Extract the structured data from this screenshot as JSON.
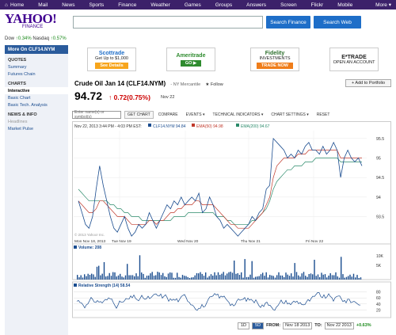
{
  "topnav": {
    "items": [
      "Home",
      "Mail",
      "News",
      "Sports",
      "Finance",
      "Weather",
      "Games",
      "Groups",
      "Answers",
      "Screen",
      "Flickr",
      "Mobile"
    ],
    "more": "More ▾"
  },
  "logo": {
    "main": "YAHOO!",
    "sub": "FINANCE"
  },
  "search": {
    "finance_btn": "Search Finance",
    "web_btn": "Search Web"
  },
  "ticker": {
    "dow_label": "Dow",
    "dow_change": "0.34%",
    "nasdaq_label": "Nasdaq",
    "nasdaq_change": "0.57%"
  },
  "sidebar": {
    "title": "More On CLF14.NYM",
    "sections": [
      {
        "heading": "QUOTES",
        "links": [
          "Summary",
          "Futures Chain"
        ]
      },
      {
        "heading": "CHARTS",
        "links": [
          "Interactive",
          "Basic Chart",
          "Basic Tech. Analysis"
        ]
      },
      {
        "heading": "NEWS & INFO",
        "links": [
          "Headlines",
          "Market Pulse"
        ]
      }
    ]
  },
  "ads": [
    {
      "brand": "Scottrade",
      "line": "Get Up to $1,000",
      "button": "See Details",
      "color": "#1e6ec8",
      "btn_color": "#f7a51c"
    },
    {
      "brand": "Ameritrade",
      "line": "",
      "button": "GO ▶",
      "color": "#2e8b2e",
      "btn_color": "#2e8b2e"
    },
    {
      "brand": "Fidelity",
      "line": "INVESTMENTS",
      "button": "TRADE NOW",
      "color": "#2b6e2b",
      "btn_color": "#ef7d1a"
    },
    {
      "brand": "E*TRADE",
      "line": "OPEN AN ACCOUNT",
      "button": "",
      "color": "#222",
      "btn_color": "#6b3fa0"
    }
  ],
  "quote": {
    "title": "Crude Oil Jan 14 (CLF14.NYM)",
    "exchange": "- NY Mercantile",
    "follow": "★ Follow",
    "price": "94.72",
    "change": "↑ 0.72(0.75%)",
    "date": "Nov 22",
    "add_portfolio": "+ Add to Portfolio"
  },
  "toolbar": {
    "compare_placeholder": "Enter name(s) or symbol(s)",
    "get_chart": "GET CHART",
    "items": [
      "COMPARE",
      "EVENTS ▾",
      "TECHNICAL INDICATORS ▾",
      "CHART SETTINGS ▾",
      "RESET"
    ]
  },
  "legend": {
    "date": "Nov 22, 2013 3:44 PM - 4:03 PM EST:",
    "series": [
      {
        "name": "CLF14.NYM 94.84",
        "color": "#1a4c8f"
      },
      {
        "name": "EMA(50) 94.98",
        "color": "#c0392b"
      },
      {
        "name": "EMA(200) 94.67",
        "color": "#2a8a6a"
      }
    ],
    "copyright": "© 2013 Yahoo! Inc."
  },
  "chart_data": {
    "type": "line",
    "main": {
      "x_labels": [
        "Tue Nov 19",
        "Wed Nov 20",
        "Thu Nov 21",
        "Fri Nov 22"
      ],
      "x_label_top": "Mon Nov 18, 2013",
      "y_ticks": [
        93.5,
        94.0,
        94.5,
        95.0,
        95.5
      ],
      "ylim": [
        92.9,
        95.7
      ],
      "price": [
        93.9,
        93.6,
        93.3,
        93.2,
        93.5,
        94.2,
        94.8,
        94.3,
        93.9,
        93.5,
        93.2,
        93.1,
        93.3,
        93.5,
        93.2,
        93.0,
        93.1,
        93.3,
        93.2,
        93.3,
        93.6,
        93.4,
        93.2,
        93.4,
        93.6,
        93.8,
        93.7,
        93.9,
        93.8,
        94.0,
        93.8,
        93.9,
        94.0,
        93.9,
        94.1,
        93.6,
        93.7,
        94.0,
        93.8,
        93.5,
        93.4,
        93.2,
        93.3,
        93.2,
        93.1,
        93.0,
        93.1,
        93.2,
        93.3,
        93.5,
        93.4,
        93.6,
        93.7,
        94.2,
        94.3,
        95.5,
        95.4,
        95.3,
        95.2,
        95.0,
        95.1,
        95.0,
        95.2,
        95.1,
        95.3,
        95.4,
        95.2,
        95.2,
        95.1,
        95.3,
        95.1,
        95.2,
        95.4,
        95.2,
        94.5,
        95.0,
        95.2,
        95.0,
        94.9,
        95.0,
        94.8
      ],
      "ema50": [
        93.9,
        93.8,
        93.7,
        93.6,
        93.6,
        93.7,
        93.9,
        93.9,
        93.8,
        93.7,
        93.6,
        93.5,
        93.5,
        93.5,
        93.4,
        93.3,
        93.3,
        93.3,
        93.3,
        93.3,
        93.4,
        93.4,
        93.3,
        93.4,
        93.4,
        93.5,
        93.6,
        93.6,
        93.7,
        93.7,
        93.8,
        93.8,
        93.8,
        93.9,
        93.9,
        93.8,
        93.8,
        93.8,
        93.8,
        93.7,
        93.6,
        93.5,
        93.4,
        93.3,
        93.3,
        93.2,
        93.2,
        93.2,
        93.2,
        93.3,
        93.4,
        93.5,
        93.6,
        93.8,
        94.0,
        94.5,
        94.8,
        94.9,
        95.0,
        95.0,
        95.0,
        95.0,
        95.1,
        95.1,
        95.1,
        95.2,
        95.2,
        95.2,
        95.2,
        95.2,
        95.2,
        95.2,
        95.2,
        95.2,
        95.0,
        95.0,
        95.0,
        95.0,
        95.0,
        95.0,
        95.0
      ],
      "ema200": [
        94.2,
        94.1,
        94.0,
        93.9,
        93.9,
        93.9,
        93.9,
        93.9,
        93.9,
        93.8,
        93.8,
        93.7,
        93.7,
        93.6,
        93.6,
        93.5,
        93.5,
        93.5,
        93.4,
        93.4,
        93.4,
        93.4,
        93.4,
        93.4,
        93.4,
        93.4,
        93.4,
        93.5,
        93.5,
        93.5,
        93.5,
        93.6,
        93.6,
        93.6,
        93.6,
        93.6,
        93.6,
        93.6,
        93.6,
        93.5,
        93.5,
        93.5,
        93.4,
        93.4,
        93.3,
        93.3,
        93.3,
        93.3,
        93.3,
        93.4,
        93.4,
        93.5,
        93.6,
        93.7,
        93.9,
        94.2,
        94.4,
        94.5,
        94.6,
        94.7,
        94.7,
        94.8,
        94.8,
        94.8,
        94.9,
        94.9,
        94.9,
        95.0,
        95.0,
        95.0,
        95.0,
        95.0,
        95.0,
        95.0,
        94.9,
        94.9,
        94.9,
        94.9,
        94.9,
        94.9,
        94.9
      ]
    },
    "volume": {
      "label": "Volume: 208",
      "y_ticks": [
        "10K",
        "5K"
      ],
      "ymax": 12000
    },
    "rsi": {
      "label": "Relative Strength (14) 58.54",
      "y_ticks": [
        80,
        60,
        40,
        20
      ],
      "ylim": [
        0,
        100
      ]
    }
  },
  "range": {
    "buttons": [
      "1D",
      "5D"
    ],
    "selected": "5D",
    "from_label": "FROM:",
    "from": "Nov 18 2013",
    "to_label": "TO:",
    "to": "Nov 22 2013",
    "pct": "+0.63%"
  }
}
